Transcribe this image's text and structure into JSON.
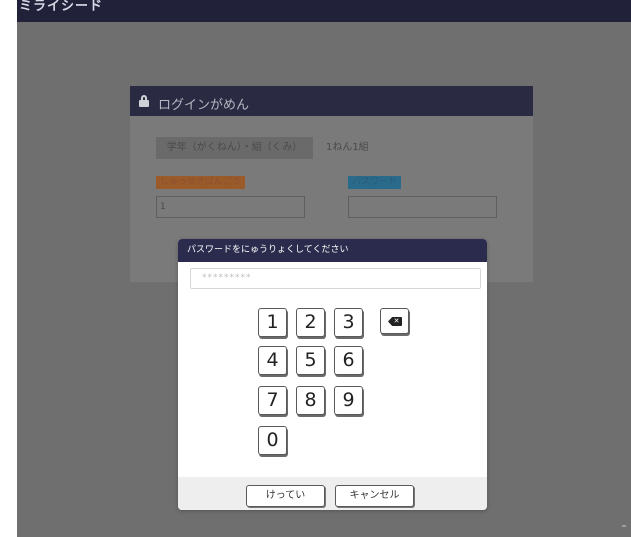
{
  "app": {
    "logo_text": "ミライシード"
  },
  "login": {
    "title": "ログインがめん",
    "grade_label": "学年（がくねん）・組（くみ）",
    "grade_value": "1ねん1組",
    "student_number_label": "しゅっせきばんごう",
    "student_number_value": "1",
    "password_label": "パスワード"
  },
  "dialog": {
    "title": "パスワードをにゅうりょくしてください",
    "password_mask": "*********",
    "keys": [
      "1",
      "2",
      "3",
      "4",
      "5",
      "6",
      "7",
      "8",
      "9",
      "0"
    ],
    "backspace_icon": "backspace-icon",
    "confirm_label": "けってい",
    "cancel_label": "キャンセル"
  },
  "colors": {
    "header": "#2b2b4e",
    "overlay": "#6f6f6f",
    "student_tag": "#9b5a2a",
    "password_tag": "#2a6a8a"
  }
}
